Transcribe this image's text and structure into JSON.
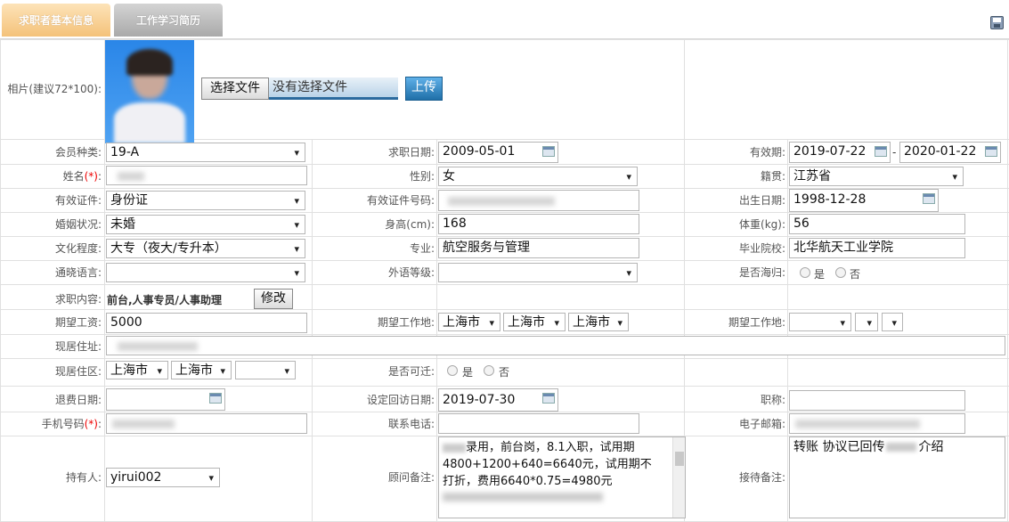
{
  "tabs": {
    "basic": "求职者基本信息",
    "history": "工作学习简历"
  },
  "photo": {
    "label": "相片(建议72*100):",
    "file_button": "选择文件",
    "file_status": "没有选择文件",
    "upload_button": "上传"
  },
  "fields": {
    "member_type": {
      "label": "会员种类:",
      "value": "19-A"
    },
    "apply_date": {
      "label": "求职日期:",
      "value": "2009-05-01"
    },
    "valid_period": {
      "label": "有效期:",
      "from": "2019-07-22",
      "sep": "-",
      "to": "2020-01-22"
    },
    "name": {
      "label": "姓名",
      "required": "(*)",
      ":": ":"
    },
    "gender": {
      "label": "性别:",
      "value": "女"
    },
    "native_place": {
      "label": "籍贯:",
      "value": "江苏省"
    },
    "id_type": {
      "label": "有效证件:",
      "value": "身份证"
    },
    "id_number": {
      "label": "有效证件号码:"
    },
    "birth_date": {
      "label": "出生日期:",
      "value": "1998-12-28"
    },
    "marital": {
      "label": "婚姻状况:",
      "value": "未婚"
    },
    "height": {
      "label": "身高(cm):",
      "value": "168"
    },
    "weight": {
      "label": "体重(kg):",
      "value": "56"
    },
    "education": {
      "label": "文化程度:",
      "value": "大专（夜大/专升本）"
    },
    "major": {
      "label": "专业:",
      "value": "航空服务与管理"
    },
    "school": {
      "label": "毕业院校:",
      "value": "北华航天工业学院"
    },
    "language": {
      "label": "通晓语言:",
      "value": ""
    },
    "foreign_level": {
      "label": "外语等级:",
      "value": ""
    },
    "returnee": {
      "label": "是否海归:",
      "yes": "是",
      "no": "否"
    },
    "job_content": {
      "label": "求职内容:",
      "value": "前台,人事专员/人事助理",
      "edit_button": "修改"
    },
    "salary": {
      "label": "期望工资:",
      "value": "5000"
    },
    "work_place1": {
      "label": "期望工作地:",
      "province": "上海市",
      "city": "上海市",
      "district": "上海市"
    },
    "work_place2": {
      "label": "期望工作地:"
    },
    "address": {
      "label": "现居住址:"
    },
    "area": {
      "label": "现居住区:",
      "province": "上海市",
      "city": "上海市"
    },
    "relocate": {
      "label": "是否可迁:",
      "yes": "是",
      "no": "否"
    },
    "refund_date": {
      "label": "退费日期:"
    },
    "revisit_date": {
      "label": "设定回访日期:",
      "value": "2019-07-30"
    },
    "title": {
      "label": "职称:"
    },
    "mobile": {
      "label": "手机号码",
      "required": "(*)",
      ":": ":"
    },
    "phone": {
      "label": "联系电话:"
    },
    "email": {
      "label": "电子邮箱:"
    },
    "holder": {
      "label": "持有人:",
      "value": "yirui002"
    },
    "consultant_note": {
      "label": "顾问备注:",
      "line1": "录用，前台岗，8.1入职，试用期",
      "line2": "4800+1200+640=6640元，试用期不",
      "line3": "打折，费用6640*0.75=4980元"
    },
    "reception_note": {
      "label": "接待备注:",
      "text": "转账 协议已回传",
      "tail": "介绍"
    }
  },
  "colors": {
    "tab_active": "#f4c27a",
    "tab_inactive": "#a9a9a9",
    "required": "#ee0000",
    "upload_button": "#2b7fb8"
  }
}
